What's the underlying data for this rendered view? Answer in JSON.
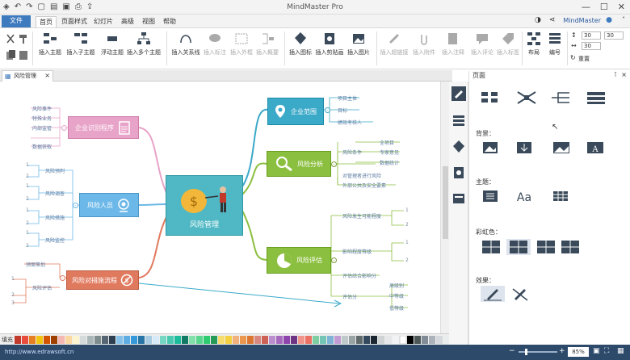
{
  "app": {
    "title": "MindMaster Pro",
    "user": "MindMaster"
  },
  "menu": {
    "file": "文件",
    "tabs": [
      "首页",
      "页面样式",
      "幻灯片",
      "高级",
      "视图",
      "帮助"
    ],
    "active": "首页"
  },
  "ribbon": {
    "buttons": [
      "插入主题",
      "插入子主题",
      "浮动主题",
      "插入多个主题",
      "插入关系线",
      "插入标注",
      "插入外框",
      "插入概要",
      "插入图标",
      "插入剪贴画",
      "插入图片",
      "插入超链接",
      "插入附件",
      "插入注释",
      "插入评论",
      "插入标签",
      "布局",
      "编号",
      "重置"
    ],
    "spin1": "30",
    "spin2": "30",
    "spin3": "30"
  },
  "doc_tab": {
    "label": "风险管理"
  },
  "sidepanel": {
    "title": "页面",
    "background": "背景：",
    "theme": "主题：",
    "rainbow": "彩虹色：",
    "effect": "效果："
  },
  "mindmap": {
    "center": "风险管理",
    "topics": {
      "t1": {
        "label": "企业识别程序",
        "leaves": [
          "风险事件",
          "特殊业务",
          "内部监管",
          "数据获取"
        ]
      },
      "t2": {
        "label": "风险人员",
        "leaves": [
          "风险预判",
          "风险调查",
          "风险措施",
          "风险监控"
        ]
      },
      "t3": {
        "label": "风险对措施流程",
        "leaves": [
          "预案策划",
          "风险评估"
        ]
      },
      "t4": {
        "label": "企业范围",
        "leaves": [
          "项目主体",
          "目标",
          "绩效考核人"
        ]
      },
      "t5": {
        "label": "风险分析",
        "leaves": [
          "风险条件",
          "全项目",
          "专家意见",
          "数据统计",
          "对管理者进行风险",
          "外部公共及安全要素"
        ]
      },
      "t6": {
        "label": "风险评估",
        "leaves": [
          "风险发生可能程度",
          "影响程度等级",
          "评估综合影响分",
          "评估分",
          "高级别",
          "中等级",
          "低等级"
        ]
      }
    }
  },
  "statusbar": {
    "url": "http://www.edrawsoft.cn",
    "zoom": "85%",
    "fill_label": "填充"
  },
  "colors": {
    "accent": "#3e7abe",
    "status": "#2d4a6b",
    "center": "#4fb8c4",
    "pink": "#e8a3c8",
    "blue": "#6cb8e8",
    "red": "#e07a5f",
    "teal": "#3ba9c8",
    "green": "#8bbf3f"
  }
}
